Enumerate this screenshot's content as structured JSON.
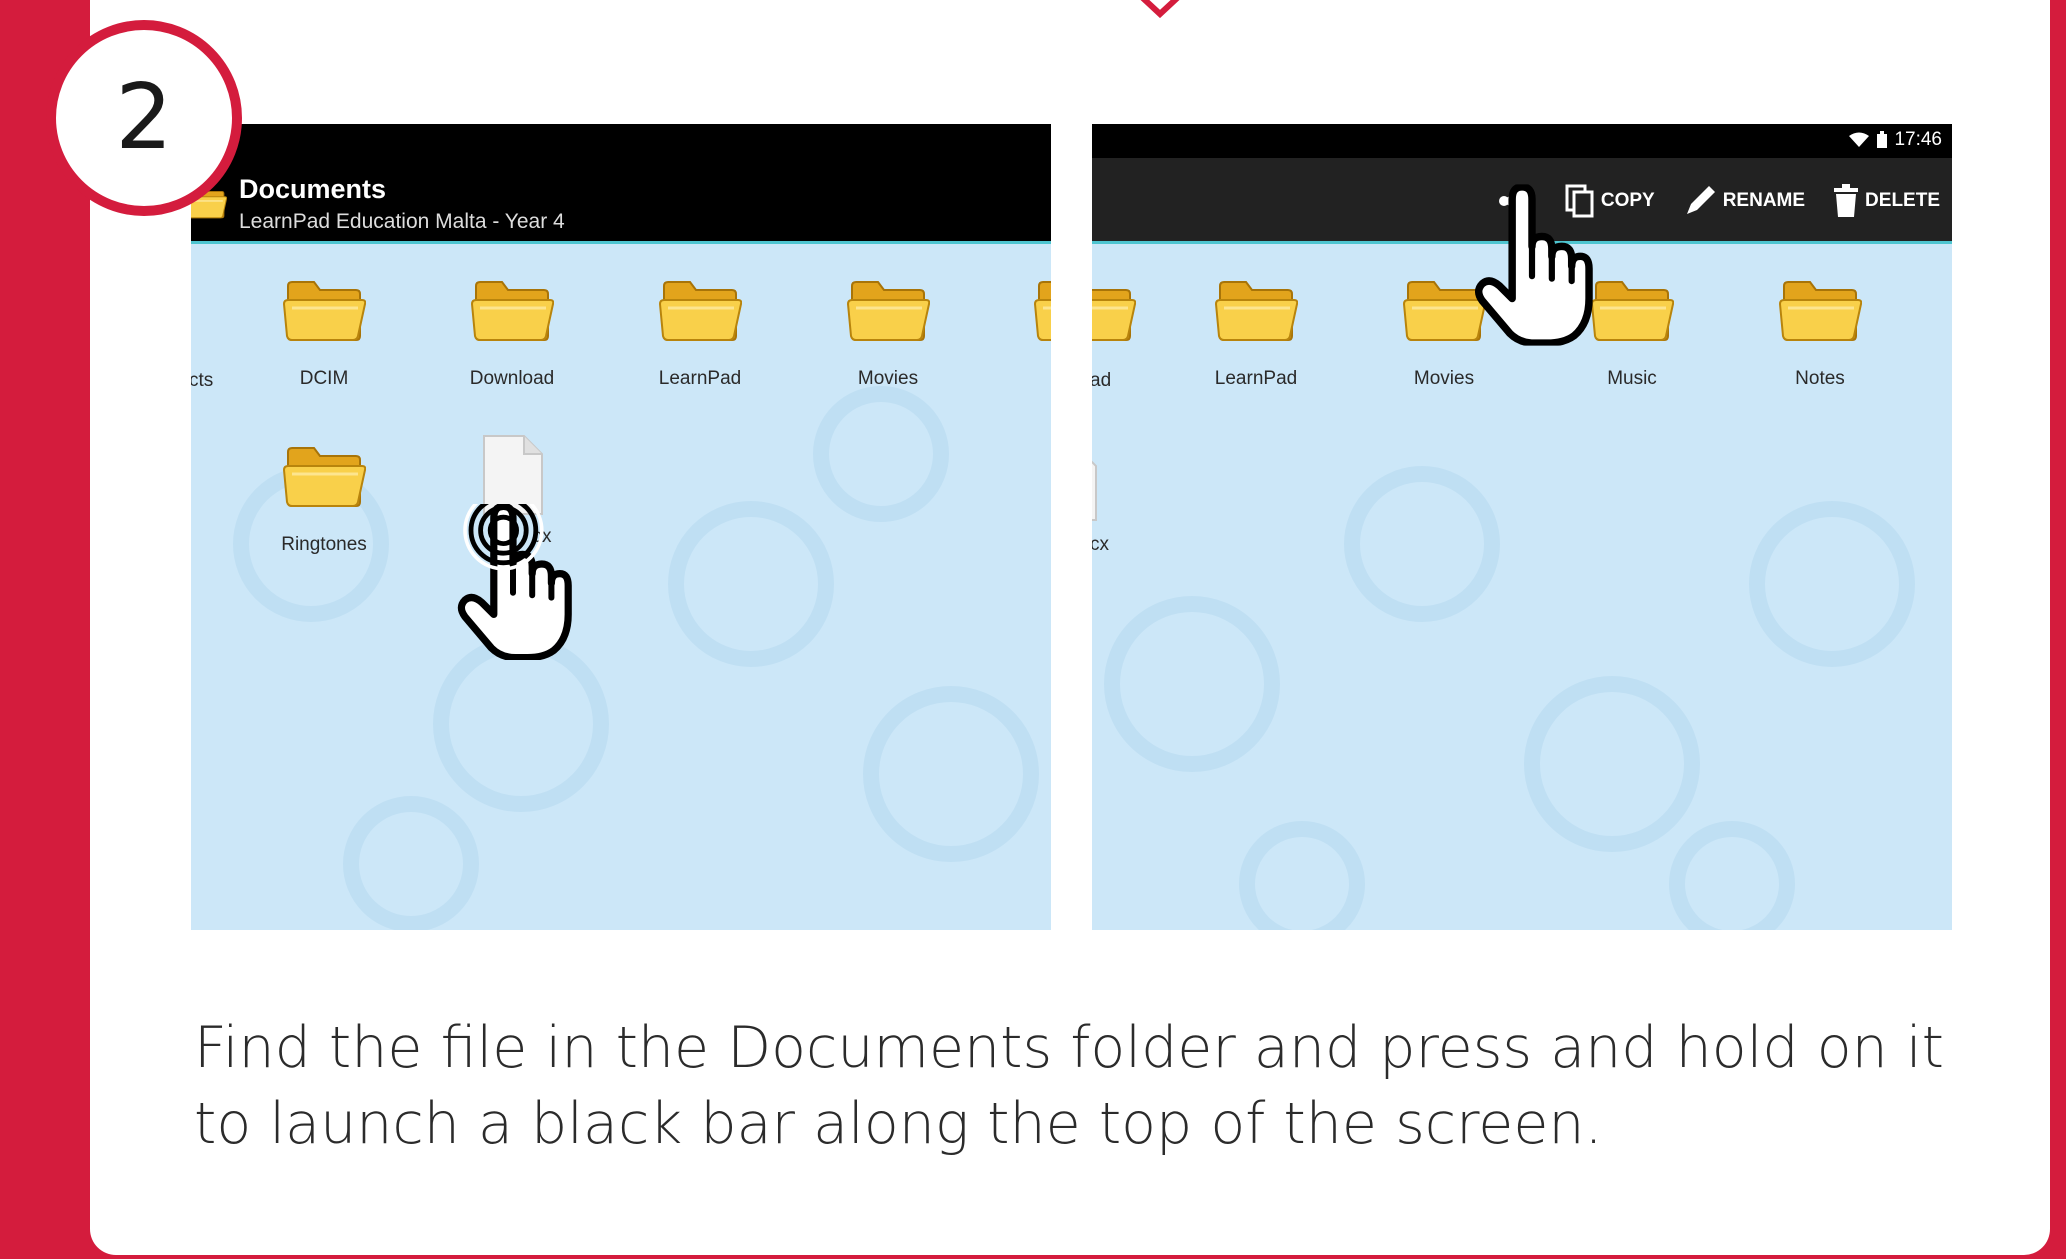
{
  "step": {
    "number": "2"
  },
  "left_screen": {
    "action_bar": {
      "title": "Documents",
      "subtitle": "LearnPad Education Malta - Year 4"
    },
    "items_row1": [
      {
        "label": "cts",
        "icon": "folder-icon",
        "partial": true
      },
      {
        "label": "DCIM",
        "icon": "folder-icon"
      },
      {
        "label": "Download",
        "icon": "folder-icon"
      },
      {
        "label": "LearnPad",
        "icon": "folder-icon"
      },
      {
        "label": "Movies",
        "icon": "folder-icon"
      }
    ],
    "items_row2": [
      {
        "label": "Ringtones",
        "icon": "folder-icon"
      },
      {
        "label": "cx",
        "icon": "document-icon"
      }
    ],
    "gesture": "press-and-hold-hand-icon"
  },
  "right_screen": {
    "status_bar": {
      "time": "17:46"
    },
    "actions": [
      {
        "label": "",
        "icon": "share-icon"
      },
      {
        "label": "COPY",
        "icon": "copy-icon"
      },
      {
        "label": "RENAME",
        "icon": "pencil-icon"
      },
      {
        "label": "DELETE",
        "icon": "trash-icon"
      }
    ],
    "items_row1": [
      {
        "label": "ad",
        "icon": "folder-icon",
        "partial": true
      },
      {
        "label": "LearnPad",
        "icon": "folder-icon"
      },
      {
        "label": "Movies",
        "icon": "folder-icon"
      },
      {
        "label": "Music",
        "icon": "folder-icon"
      },
      {
        "label": "Notes",
        "icon": "folder-icon"
      }
    ],
    "items_row2": [
      {
        "label": "cx",
        "icon": "document-icon",
        "partial": true
      }
    ],
    "gesture": "tap-hand-icon"
  },
  "caption": "Find the file in the Documents folder and press and hold on it to launch a black bar along the top of the screen.",
  "colors": {
    "brand_red": "#d41c3d",
    "screen_bg": "#cce7f8",
    "folder_yellow": "#f7c73a",
    "accent_teal": "#4ec5d0"
  }
}
